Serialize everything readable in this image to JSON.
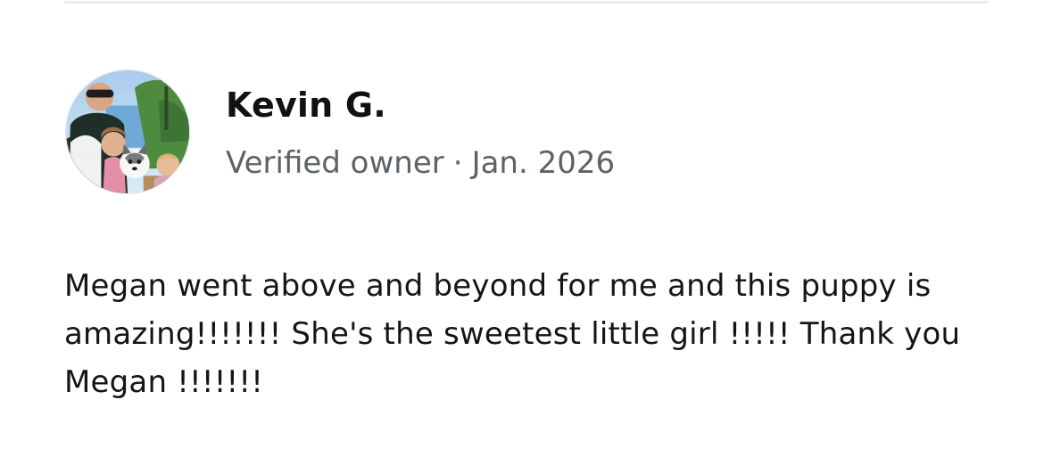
{
  "review": {
    "author_name": "Kevin G.",
    "badge": "Verified owner",
    "separator": "·",
    "date": "Jan. 2026",
    "text": "Megan went above and beyond for me and this puppy is amazing!!!!!!! She's the sweetest little girl !!!!! Thank you Megan !!!!!!!"
  }
}
